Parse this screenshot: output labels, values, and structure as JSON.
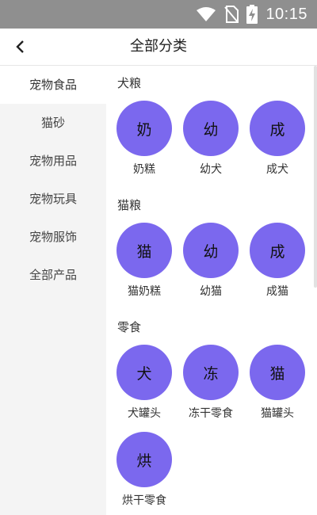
{
  "status_bar": {
    "time": "10:15",
    "icons": [
      "wifi-icon",
      "no-sim-icon",
      "battery-charging-icon"
    ]
  },
  "header": {
    "back_icon": "chevron-left-icon",
    "title": "全部分类"
  },
  "sidebar": {
    "items": [
      {
        "label": "宠物食品",
        "active": true
      },
      {
        "label": "猫砂",
        "active": false
      },
      {
        "label": "宠物用品",
        "active": false
      },
      {
        "label": "宠物玩具",
        "active": false
      },
      {
        "label": "宠物服饰",
        "active": false
      },
      {
        "label": "全部产品",
        "active": false
      }
    ]
  },
  "content": {
    "sections": [
      {
        "title": "犬粮",
        "items": [
          {
            "glyph": "奶",
            "label": "奶糕"
          },
          {
            "glyph": "幼",
            "label": "幼犬"
          },
          {
            "glyph": "成",
            "label": "成犬"
          }
        ]
      },
      {
        "title": "猫粮",
        "items": [
          {
            "glyph": "猫",
            "label": "猫奶糕"
          },
          {
            "glyph": "幼",
            "label": "幼猫"
          },
          {
            "glyph": "成",
            "label": "成猫"
          }
        ]
      },
      {
        "title": "零食",
        "items": [
          {
            "glyph": "犬",
            "label": "犬罐头"
          },
          {
            "glyph": "冻",
            "label": "冻干零食"
          },
          {
            "glyph": "猫",
            "label": "猫罐头"
          },
          {
            "glyph": "烘",
            "label": "烘干零食"
          }
        ]
      }
    ]
  },
  "colors": {
    "status_bar_bg": "#8f8f8f",
    "circle": "#7b68ee",
    "sidebar_bg": "#f4f4f4",
    "active_bg": "#ffffff"
  }
}
